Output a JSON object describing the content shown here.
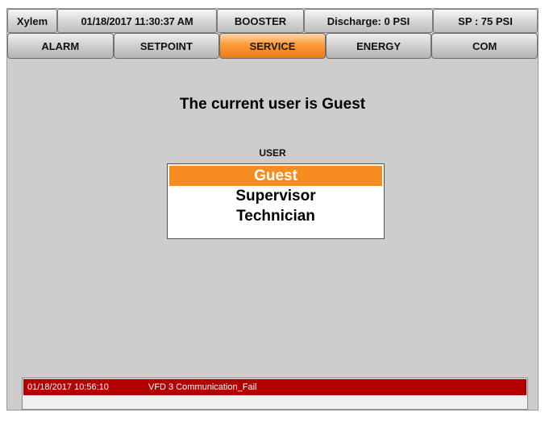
{
  "status_bar": {
    "brand": "Xylem",
    "datetime": "01/18/2017 11:30:37 AM",
    "system": "BOOSTER",
    "discharge": "Discharge: 0 PSI",
    "setpoint": "SP : 75 PSI"
  },
  "tabs": [
    {
      "label": "ALARM",
      "active": false
    },
    {
      "label": "SETPOINT",
      "active": false
    },
    {
      "label": "SERVICE",
      "active": true
    },
    {
      "label": "ENERGY",
      "active": false
    },
    {
      "label": "COM",
      "active": false
    }
  ],
  "main": {
    "current_user_text": "The current user is Guest",
    "user_label": "USER",
    "users": [
      {
        "label": "Guest",
        "selected": true
      },
      {
        "label": "Supervisor",
        "selected": false
      },
      {
        "label": "Technician",
        "selected": false
      }
    ]
  },
  "alarm": {
    "timestamp": "01/18/2017 10:56:10",
    "message": "VFD 3 Communication_Fail"
  },
  "colors": {
    "active_tab": "#f68b1f",
    "selected_option": "#f68b1f",
    "alarm_row": "#b30000",
    "background": "#cdcdcd"
  }
}
